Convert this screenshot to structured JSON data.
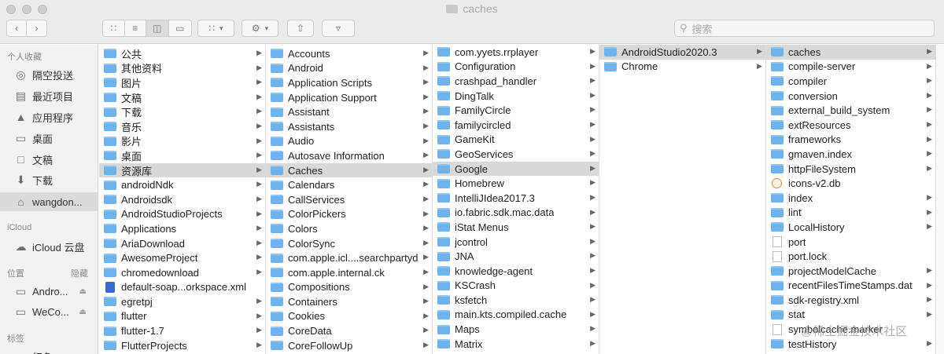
{
  "window": {
    "title": "caches"
  },
  "toolbar": {
    "search_placeholder": "搜索",
    "view_icons": [
      "icon-view-icon",
      "list-view-icon",
      "column-view-icon",
      "gallery-view-icon"
    ],
    "selected_view": "column"
  },
  "sidebar": {
    "favorites_header": "个人收藏",
    "favorites": [
      {
        "label": "隔空投送",
        "icon": "airdrop-icon"
      },
      {
        "label": "最近项目",
        "icon": "recents-icon"
      },
      {
        "label": "应用程序",
        "icon": "applications-icon"
      },
      {
        "label": "桌面",
        "icon": "desktop-icon"
      },
      {
        "label": "文稿",
        "icon": "documents-icon"
      },
      {
        "label": "下载",
        "icon": "downloads-icon"
      },
      {
        "label": "wangdon...",
        "icon": "home-icon",
        "selected": true
      }
    ],
    "icloud_header": "iCloud",
    "icloud": [
      {
        "label": "iCloud 云盘",
        "icon": "cloud-icon"
      }
    ],
    "locations_header": "位置",
    "locations_hide": "隐藏",
    "locations": [
      {
        "label": "Andro...",
        "icon": "disk-icon"
      },
      {
        "label": "WeCo...",
        "icon": "disk-icon"
      }
    ],
    "tags_header": "标签",
    "tags": [
      {
        "label": "红色"
      }
    ]
  },
  "columns": [
    {
      "items": [
        {
          "name": "公共",
          "type": "folder",
          "arrow": true
        },
        {
          "name": "其他资料",
          "type": "folder",
          "arrow": true
        },
        {
          "name": "图片",
          "type": "folder",
          "arrow": true
        },
        {
          "name": "文稿",
          "type": "folder",
          "arrow": true
        },
        {
          "name": "下载",
          "type": "folder",
          "arrow": true
        },
        {
          "name": "音乐",
          "type": "folder",
          "arrow": true
        },
        {
          "name": "影片",
          "type": "folder",
          "arrow": true
        },
        {
          "name": "桌面",
          "type": "folder",
          "arrow": true
        },
        {
          "name": "资源库",
          "type": "folder",
          "arrow": true,
          "selected": true
        },
        {
          "name": "androidNdk",
          "type": "folder",
          "arrow": true
        },
        {
          "name": "Androidsdk",
          "type": "folder",
          "arrow": true
        },
        {
          "name": "AndroidStudioProjects",
          "type": "folder",
          "arrow": true
        },
        {
          "name": "Applications",
          "type": "folder",
          "arrow": true
        },
        {
          "name": "AriaDownload",
          "type": "folder",
          "arrow": true
        },
        {
          "name": "AwesomeProject",
          "type": "folder",
          "arrow": true
        },
        {
          "name": "chromedownload",
          "type": "folder",
          "arrow": true
        },
        {
          "name": "default-soap...orkspace.xml",
          "type": "xml",
          "arrow": false
        },
        {
          "name": "egretpj",
          "type": "folder",
          "arrow": true
        },
        {
          "name": "flutter",
          "type": "folder",
          "arrow": true
        },
        {
          "name": "flutter-1.7",
          "type": "folder",
          "arrow": true
        },
        {
          "name": "FlutterProjects",
          "type": "folder",
          "arrow": true
        }
      ]
    },
    {
      "items": [
        {
          "name": "Accounts",
          "type": "folder",
          "arrow": true
        },
        {
          "name": "Android",
          "type": "folder",
          "arrow": true
        },
        {
          "name": "Application Scripts",
          "type": "folder",
          "arrow": true
        },
        {
          "name": "Application Support",
          "type": "folder",
          "arrow": true
        },
        {
          "name": "Assistant",
          "type": "folder",
          "arrow": true
        },
        {
          "name": "Assistants",
          "type": "folder",
          "arrow": true
        },
        {
          "name": "Audio",
          "type": "folder",
          "arrow": true
        },
        {
          "name": "Autosave Information",
          "type": "folder",
          "arrow": true
        },
        {
          "name": "Caches",
          "type": "folder",
          "arrow": true,
          "selected": true
        },
        {
          "name": "Calendars",
          "type": "folder",
          "arrow": true
        },
        {
          "name": "CallServices",
          "type": "folder",
          "arrow": true
        },
        {
          "name": "ColorPickers",
          "type": "folder",
          "arrow": true
        },
        {
          "name": "Colors",
          "type": "folder",
          "arrow": true
        },
        {
          "name": "ColorSync",
          "type": "folder",
          "arrow": true
        },
        {
          "name": "com.apple.icl....searchpartyd",
          "type": "folder",
          "arrow": true
        },
        {
          "name": "com.apple.internal.ck",
          "type": "folder",
          "arrow": true
        },
        {
          "name": "Compositions",
          "type": "folder",
          "arrow": true
        },
        {
          "name": "Containers",
          "type": "folder",
          "arrow": true
        },
        {
          "name": "Cookies",
          "type": "folder",
          "arrow": true
        },
        {
          "name": "CoreData",
          "type": "folder",
          "arrow": true
        },
        {
          "name": "CoreFollowUp",
          "type": "folder",
          "arrow": true
        }
      ]
    },
    {
      "items": [
        {
          "name": "com.yyets.rrplayer",
          "type": "folder",
          "arrow": true
        },
        {
          "name": "Configuration",
          "type": "folder",
          "arrow": true
        },
        {
          "name": "crashpad_handler",
          "type": "folder",
          "arrow": true
        },
        {
          "name": "DingTalk",
          "type": "folder",
          "arrow": true
        },
        {
          "name": "FamilyCircle",
          "type": "folder",
          "arrow": true
        },
        {
          "name": "familycircled",
          "type": "folder",
          "arrow": true
        },
        {
          "name": "GameKit",
          "type": "folder",
          "arrow": true
        },
        {
          "name": "GeoServices",
          "type": "folder",
          "arrow": true
        },
        {
          "name": "Google",
          "type": "folder",
          "arrow": true,
          "selected": true
        },
        {
          "name": "Homebrew",
          "type": "folder",
          "arrow": true
        },
        {
          "name": "IntelliJIdea2017.3",
          "type": "folder",
          "arrow": true
        },
        {
          "name": "io.fabric.sdk.mac.data",
          "type": "folder",
          "arrow": true
        },
        {
          "name": "iStat Menus",
          "type": "folder",
          "arrow": true
        },
        {
          "name": "jcontrol",
          "type": "folder",
          "arrow": true
        },
        {
          "name": "JNA",
          "type": "folder",
          "arrow": true
        },
        {
          "name": "knowledge-agent",
          "type": "folder",
          "arrow": true
        },
        {
          "name": "KSCrash",
          "type": "folder",
          "arrow": true
        },
        {
          "name": "ksfetch",
          "type": "folder",
          "arrow": true
        },
        {
          "name": "main.kts.compiled.cache",
          "type": "folder",
          "arrow": true
        },
        {
          "name": "Maps",
          "type": "folder",
          "arrow": true
        },
        {
          "name": "Matrix",
          "type": "folder",
          "arrow": true
        }
      ]
    },
    {
      "items": [
        {
          "name": "AndroidStudio2020.3",
          "type": "folder",
          "arrow": true,
          "selected": true
        },
        {
          "name": "Chrome",
          "type": "folder",
          "arrow": true
        }
      ]
    },
    {
      "items": [
        {
          "name": "caches",
          "type": "folder",
          "arrow": true,
          "selected": true
        },
        {
          "name": "compile-server",
          "type": "folder",
          "arrow": true
        },
        {
          "name": "compiler",
          "type": "folder",
          "arrow": true
        },
        {
          "name": "conversion",
          "type": "folder",
          "arrow": true
        },
        {
          "name": "external_build_system",
          "type": "folder",
          "arrow": true
        },
        {
          "name": "extResources",
          "type": "folder",
          "arrow": true
        },
        {
          "name": "frameworks",
          "type": "folder",
          "arrow": true
        },
        {
          "name": "gmaven.index",
          "type": "folder",
          "arrow": true
        },
        {
          "name": "httpFileSystem",
          "type": "folder",
          "arrow": true
        },
        {
          "name": "icons-v2.db",
          "type": "db",
          "arrow": false
        },
        {
          "name": "index",
          "type": "folder",
          "arrow": true
        },
        {
          "name": "lint",
          "type": "folder",
          "arrow": true
        },
        {
          "name": "LocalHistory",
          "type": "folder",
          "arrow": true
        },
        {
          "name": "port",
          "type": "doc",
          "arrow": false
        },
        {
          "name": "port.lock",
          "type": "doc",
          "arrow": false
        },
        {
          "name": "projectModelCache",
          "type": "folder",
          "arrow": true
        },
        {
          "name": "recentFilesTimeStamps.dat",
          "type": "folder",
          "arrow": true
        },
        {
          "name": "sdk-registry.xml",
          "type": "folder",
          "arrow": true
        },
        {
          "name": "stat",
          "type": "folder",
          "arrow": true
        },
        {
          "name": "symbolcache.marker",
          "type": "doc",
          "arrow": false
        },
        {
          "name": "testHistory",
          "type": "folder",
          "arrow": true
        }
      ]
    }
  ],
  "watermark": "@稀土掘金技术社区"
}
